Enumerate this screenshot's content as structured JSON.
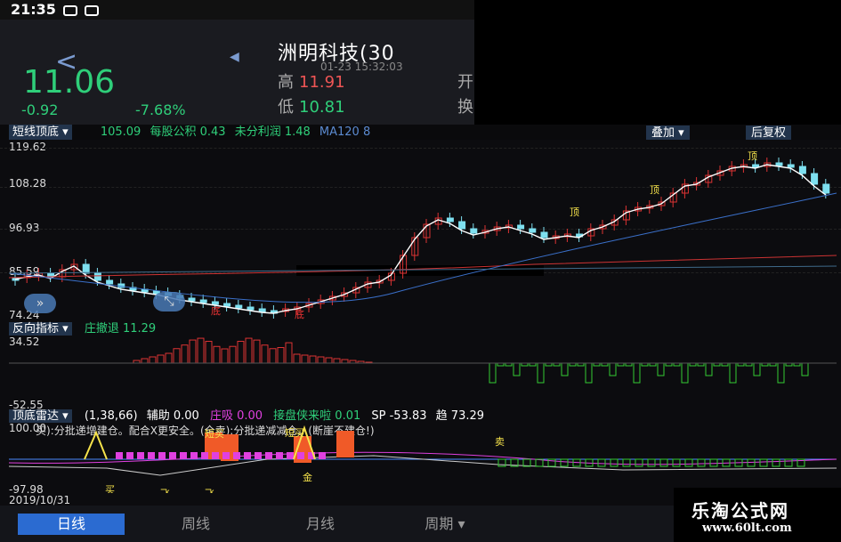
{
  "status": {
    "time": "21:35"
  },
  "header": {
    "title": "洲明科技(30",
    "time": "01-23 15:32:03",
    "price": "11.06",
    "chg": "-0.92",
    "pct": "-7.68%",
    "high_label": "高",
    "high": "11.91",
    "low_label": "低",
    "low": "10.81",
    "right1": "开",
    "right2": "换"
  },
  "kline": {
    "indicator": "短线顶底",
    "v1": "105.09",
    "eps": "每股公积 0.43",
    "undist": "未分利润 1.48",
    "ma": "MA120 8",
    "overlay": "叠加",
    "fq": "后复权",
    "y1": "119.62",
    "y2": "108.28",
    "y3": "96.93",
    "y4": "85.59",
    "y5": "74.24",
    "top": "顶",
    "bottom": "底"
  },
  "ind2": {
    "name": "反向指标",
    "txt": "庄撤退 11.29",
    "y1": "34.52",
    "y2": "-52.55"
  },
  "ind3": {
    "name": "顶底雷达",
    "params": "(1,38,66)",
    "aux": "辅助 0.00",
    "zx": "庄吸 0.00",
    "jp": "接盘侠来啦 0.01",
    "sp": "SP -53.83",
    "qu": "趋 73.29",
    "y1": "100.00",
    "tip": "买):分批递增建仓。配合X更安全。(全卖):分批递减减仓。(断崖不建仓!)",
    "y2": "-97.98",
    "date": "2019/10/31",
    "buy": "买",
    "sell": "卖",
    "dm": "短买",
    "dm2": "短买",
    "jin": "金",
    "fei": "飞"
  },
  "tabs": [
    "日线",
    "周线",
    "月线",
    "周期"
  ],
  "logo": {
    "name": "乐淘公式网",
    "url": "www.60lt.com"
  }
}
